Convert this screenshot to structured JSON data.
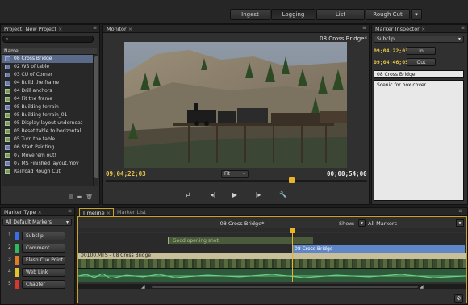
{
  "workspace": {
    "buttons": [
      {
        "label": "Ingest",
        "active": false
      },
      {
        "label": "Logging",
        "active": true
      },
      {
        "label": "List",
        "active": false
      },
      {
        "label": "Rough Cut",
        "active": false
      }
    ]
  },
  "project": {
    "tab_label": "Project: New Project",
    "column_name": "Name",
    "items": [
      {
        "label": "08 Cross Bridge",
        "kind": "clip",
        "selected": true
      },
      {
        "label": "02 WS of table",
        "kind": "clip"
      },
      {
        "label": "03 CU of Corner",
        "kind": "clip"
      },
      {
        "label": "04 Build the frame",
        "kind": "clip"
      },
      {
        "label": "04 Drill anchors",
        "kind": "seq"
      },
      {
        "label": "04 Fit the frame",
        "kind": "seq"
      },
      {
        "label": "05 Building terrain",
        "kind": "clip"
      },
      {
        "label": "05 Building terrain_01",
        "kind": "seq"
      },
      {
        "label": "05 Display layout underneat",
        "kind": "seq"
      },
      {
        "label": "05 Reset table to horizontal",
        "kind": "seq"
      },
      {
        "label": "05 Turn the table",
        "kind": "seq"
      },
      {
        "label": "06 Start Painting",
        "kind": "clip"
      },
      {
        "label": "07 Move 'em out!",
        "kind": "seq"
      },
      {
        "label": "07 MS Finished layout.mov",
        "kind": "clip"
      },
      {
        "label": "Railroad Rough Cut",
        "kind": "seq"
      }
    ]
  },
  "monitor": {
    "tab_label": "Monitor",
    "clip_title": "08 Cross Bridge*",
    "timecode_current": "09;04;22;03",
    "timecode_duration": "00;00;54;00",
    "zoom": "Fit",
    "playhead_fraction": 0.71
  },
  "inspector": {
    "tab_label": "Marker Inspector",
    "type_value": "Subclip",
    "in_timecode": "09;04;22;03",
    "out_timecode": "09;04;46;05",
    "in_label": "In",
    "out_label": "Out",
    "name_value": "08 Cross Bridge",
    "comment_value": "Scenic for box cover."
  },
  "marker_type": {
    "tab_label": "Marker Type",
    "filter_value": "All Default Markers",
    "types": [
      {
        "num": "1",
        "label": "Subclip",
        "color": "#3a6ee8"
      },
      {
        "num": "2",
        "label": "Comment",
        "color": "#2fb95e"
      },
      {
        "num": "3",
        "label": "Flash Cue Point",
        "color": "#e07b2a"
      },
      {
        "num": "4",
        "label": "Web Link",
        "color": "#e0c42a"
      },
      {
        "num": "5",
        "label": "Chapter",
        "color": "#d9362e"
      }
    ]
  },
  "timeline": {
    "tab_label": "Timeline",
    "tab_label_2": "Marker List",
    "sequence_title": "08 Cross Bridge*",
    "show_label": "Show:",
    "show_value": "All Markers",
    "comment_marker": "Good opening shot.",
    "subclip_marker": "08 Cross Bridge",
    "clip_label": "00100.MTS - 08 Cross Bridge"
  }
}
